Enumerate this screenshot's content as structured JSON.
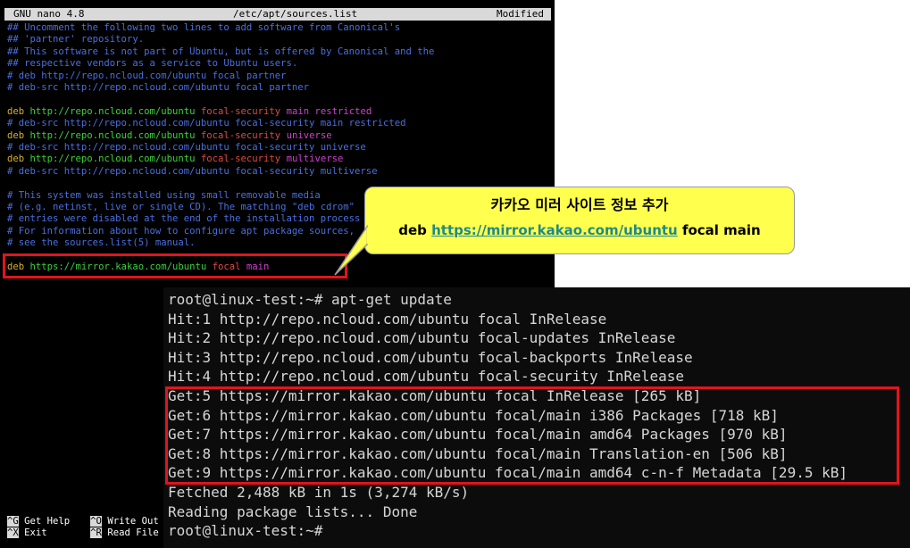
{
  "nano": {
    "header": {
      "app": "GNU nano 4.8",
      "file": "/etc/apt/sources.list",
      "status": "Modified"
    },
    "lines": [
      {
        "type": "comment",
        "text": "## Uncomment the following two lines to add software from Canonical's"
      },
      {
        "type": "comment",
        "text": "## 'partner' repository."
      },
      {
        "type": "comment",
        "text": "## This software is not part of Ubuntu, but is offered by Canonical and the"
      },
      {
        "type": "comment",
        "text": "## respective vendors as a service to Ubuntu users."
      },
      {
        "type": "comment",
        "text": "# deb http://repo.ncloud.com/ubuntu focal partner"
      },
      {
        "type": "comment",
        "text": "# deb-src http://repo.ncloud.com/ubuntu focal partner"
      },
      {
        "type": "blank",
        "text": ""
      },
      {
        "type": "deb",
        "deb": "deb",
        "url": "http://repo.ncloud.com/ubuntu",
        "suite": "focal-security",
        "components": "main restricted"
      },
      {
        "type": "comment",
        "text": "# deb-src http://repo.ncloud.com/ubuntu focal-security main restricted"
      },
      {
        "type": "deb",
        "deb": "deb",
        "url": "http://repo.ncloud.com/ubuntu",
        "suite": "focal-security",
        "components": "universe"
      },
      {
        "type": "comment",
        "text": "# deb-src http://repo.ncloud.com/ubuntu focal-security universe"
      },
      {
        "type": "deb",
        "deb": "deb",
        "url": "http://repo.ncloud.com/ubuntu",
        "suite": "focal-security",
        "components": "multiverse"
      },
      {
        "type": "comment",
        "text": "# deb-src http://repo.ncloud.com/ubuntu focal-security multiverse"
      },
      {
        "type": "blank",
        "text": ""
      },
      {
        "type": "comment",
        "text": "# This system was installed using small removable media"
      },
      {
        "type": "comment",
        "text": "# (e.g. netinst, live or single CD). The matching \"deb cdrom\""
      },
      {
        "type": "comment",
        "text": "# entries were disabled at the end of the installation process"
      },
      {
        "type": "comment",
        "text": "# For information about how to configure apt package sources,"
      },
      {
        "type": "comment",
        "text": "# see the sources.list(5) manual."
      },
      {
        "type": "blank",
        "text": ""
      },
      {
        "type": "deb",
        "deb": "deb",
        "url": "https://mirror.kakao.com/ubuntu",
        "suite": "focal",
        "components": "main"
      }
    ],
    "footer": [
      {
        "key1": "^G",
        "label1": "Get Help",
        "key2": "^O",
        "label2": "Write Out"
      },
      {
        "key1": "^X",
        "label1": "Exit",
        "key2": "^R",
        "label2": "Read File"
      }
    ]
  },
  "callout": {
    "title": "카카오 미러 사이트 정보 추가",
    "prefix": "deb ",
    "url": "https://mirror.kakao.com/ubuntu",
    "suffix": " focal main"
  },
  "terminal": {
    "lines": [
      "root@linux-test:~# apt-get update",
      "Hit:1 http://repo.ncloud.com/ubuntu focal InRelease",
      "Hit:2 http://repo.ncloud.com/ubuntu focal-updates InRelease",
      "Hit:3 http://repo.ncloud.com/ubuntu focal-backports InRelease",
      "Hit:4 http://repo.ncloud.com/ubuntu focal-security InRelease",
      "Get:5 https://mirror.kakao.com/ubuntu focal InRelease [265 kB]",
      "Get:6 https://mirror.kakao.com/ubuntu focal/main i386 Packages [718 kB]",
      "Get:7 https://mirror.kakao.com/ubuntu focal/main amd64 Packages [970 kB]",
      "Get:8 https://mirror.kakao.com/ubuntu focal/main Translation-en [506 kB]",
      "Get:9 https://mirror.kakao.com/ubuntu focal/main amd64 c-n-f Metadata [29.5 kB]",
      "Fetched 2,488 kB in 1s (3,274 kB/s)",
      "Reading package lists... Done",
      "root@linux-test:~#"
    ]
  },
  "colors": {
    "comment": "#4a6fe0",
    "deb": "#d4b030",
    "url": "#3ad23a",
    "suite": "#e04848",
    "components": "#d040d0",
    "highlight": "#e0141e",
    "callout_bg": "#ffff4d"
  }
}
